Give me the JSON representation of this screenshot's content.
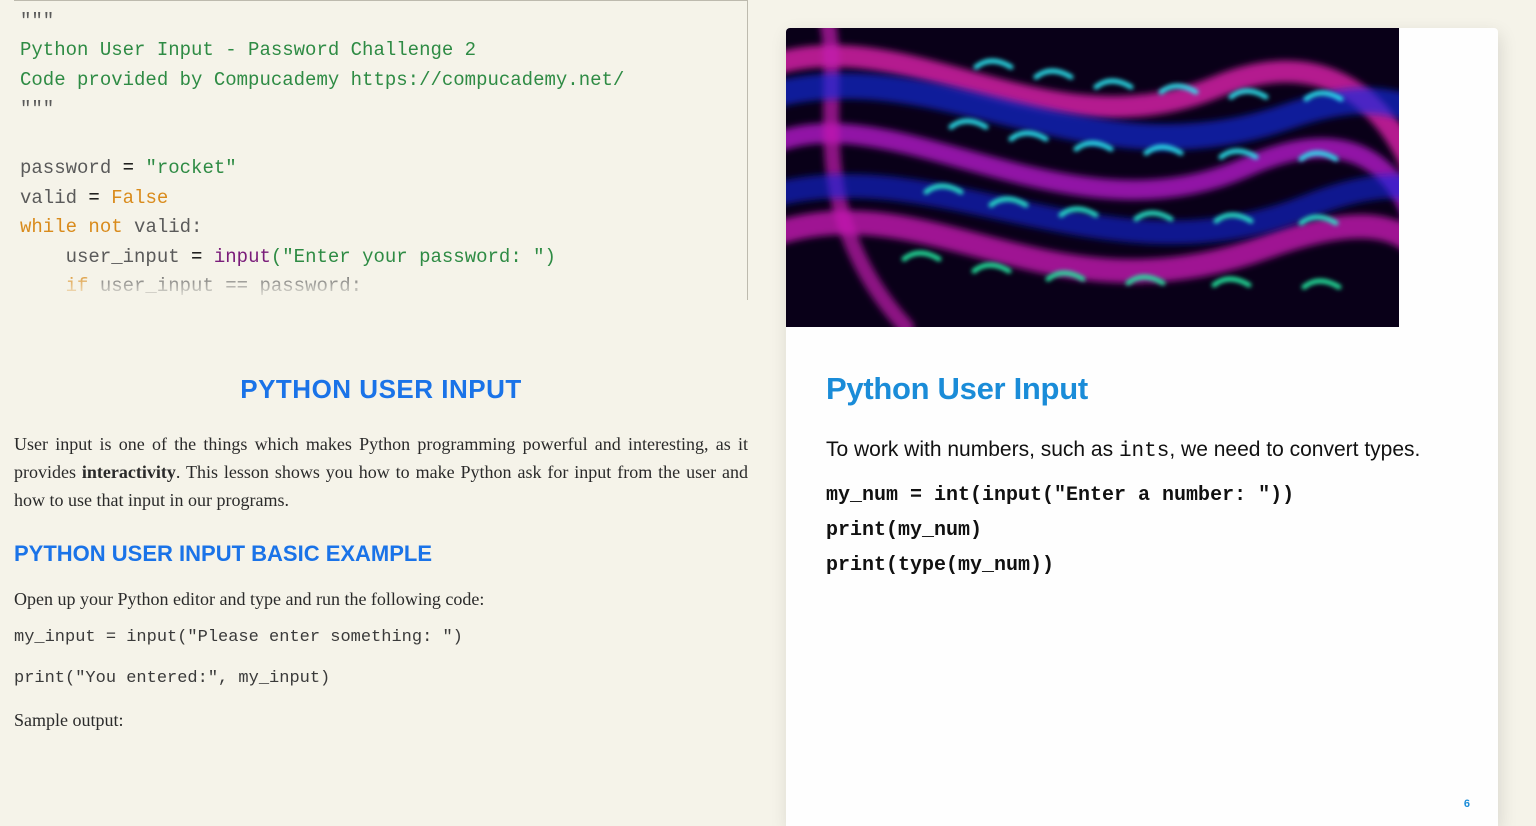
{
  "left": {
    "code": {
      "q1": "\"\"\"",
      "c1": "Python User Input - Password Challenge 2",
      "c2": "Code provided by Compucademy https://compucademy.net/",
      "q2": "\"\"\"",
      "l_password_var": "password",
      "l_password_val": "\"rocket\"",
      "l_valid_var": "valid",
      "l_kw_false": "False",
      "l_kw_while": "while",
      "l_kw_not": "not",
      "l_valid2": "valid:",
      "l_user_input": "user_input",
      "l_input": "input",
      "l_prompt": "(\"Enter your password: \")",
      "l_kw_if": "if",
      "l_if_cond": "user_input == password:"
    },
    "heading": "PYTHON USER INPUT",
    "para": "User input is one of the things which makes Python programming powerful and interesting, as it provides interactivity. This lesson shows you how to make Python ask for input from the user and how to use that input in our programs.",
    "subheading": "PYTHON USER INPUT BASIC EXAMPLE",
    "openline": "Open up your Python editor and type and run the following code:",
    "code1": "my_input = input(\"Please enter something: \")",
    "code2": "print(\"You entered:\", my_input)",
    "sample": "Sample output:"
  },
  "right": {
    "title": "Python User Input",
    "text_a": "To work with numbers, such as ",
    "text_code": "ints",
    "text_b": ", we need to convert types.",
    "code1": "my_num = int(input(\"Enter a number: \"))",
    "code2": "print(my_num)",
    "code3": "print(type(my_num))",
    "page": "6"
  }
}
